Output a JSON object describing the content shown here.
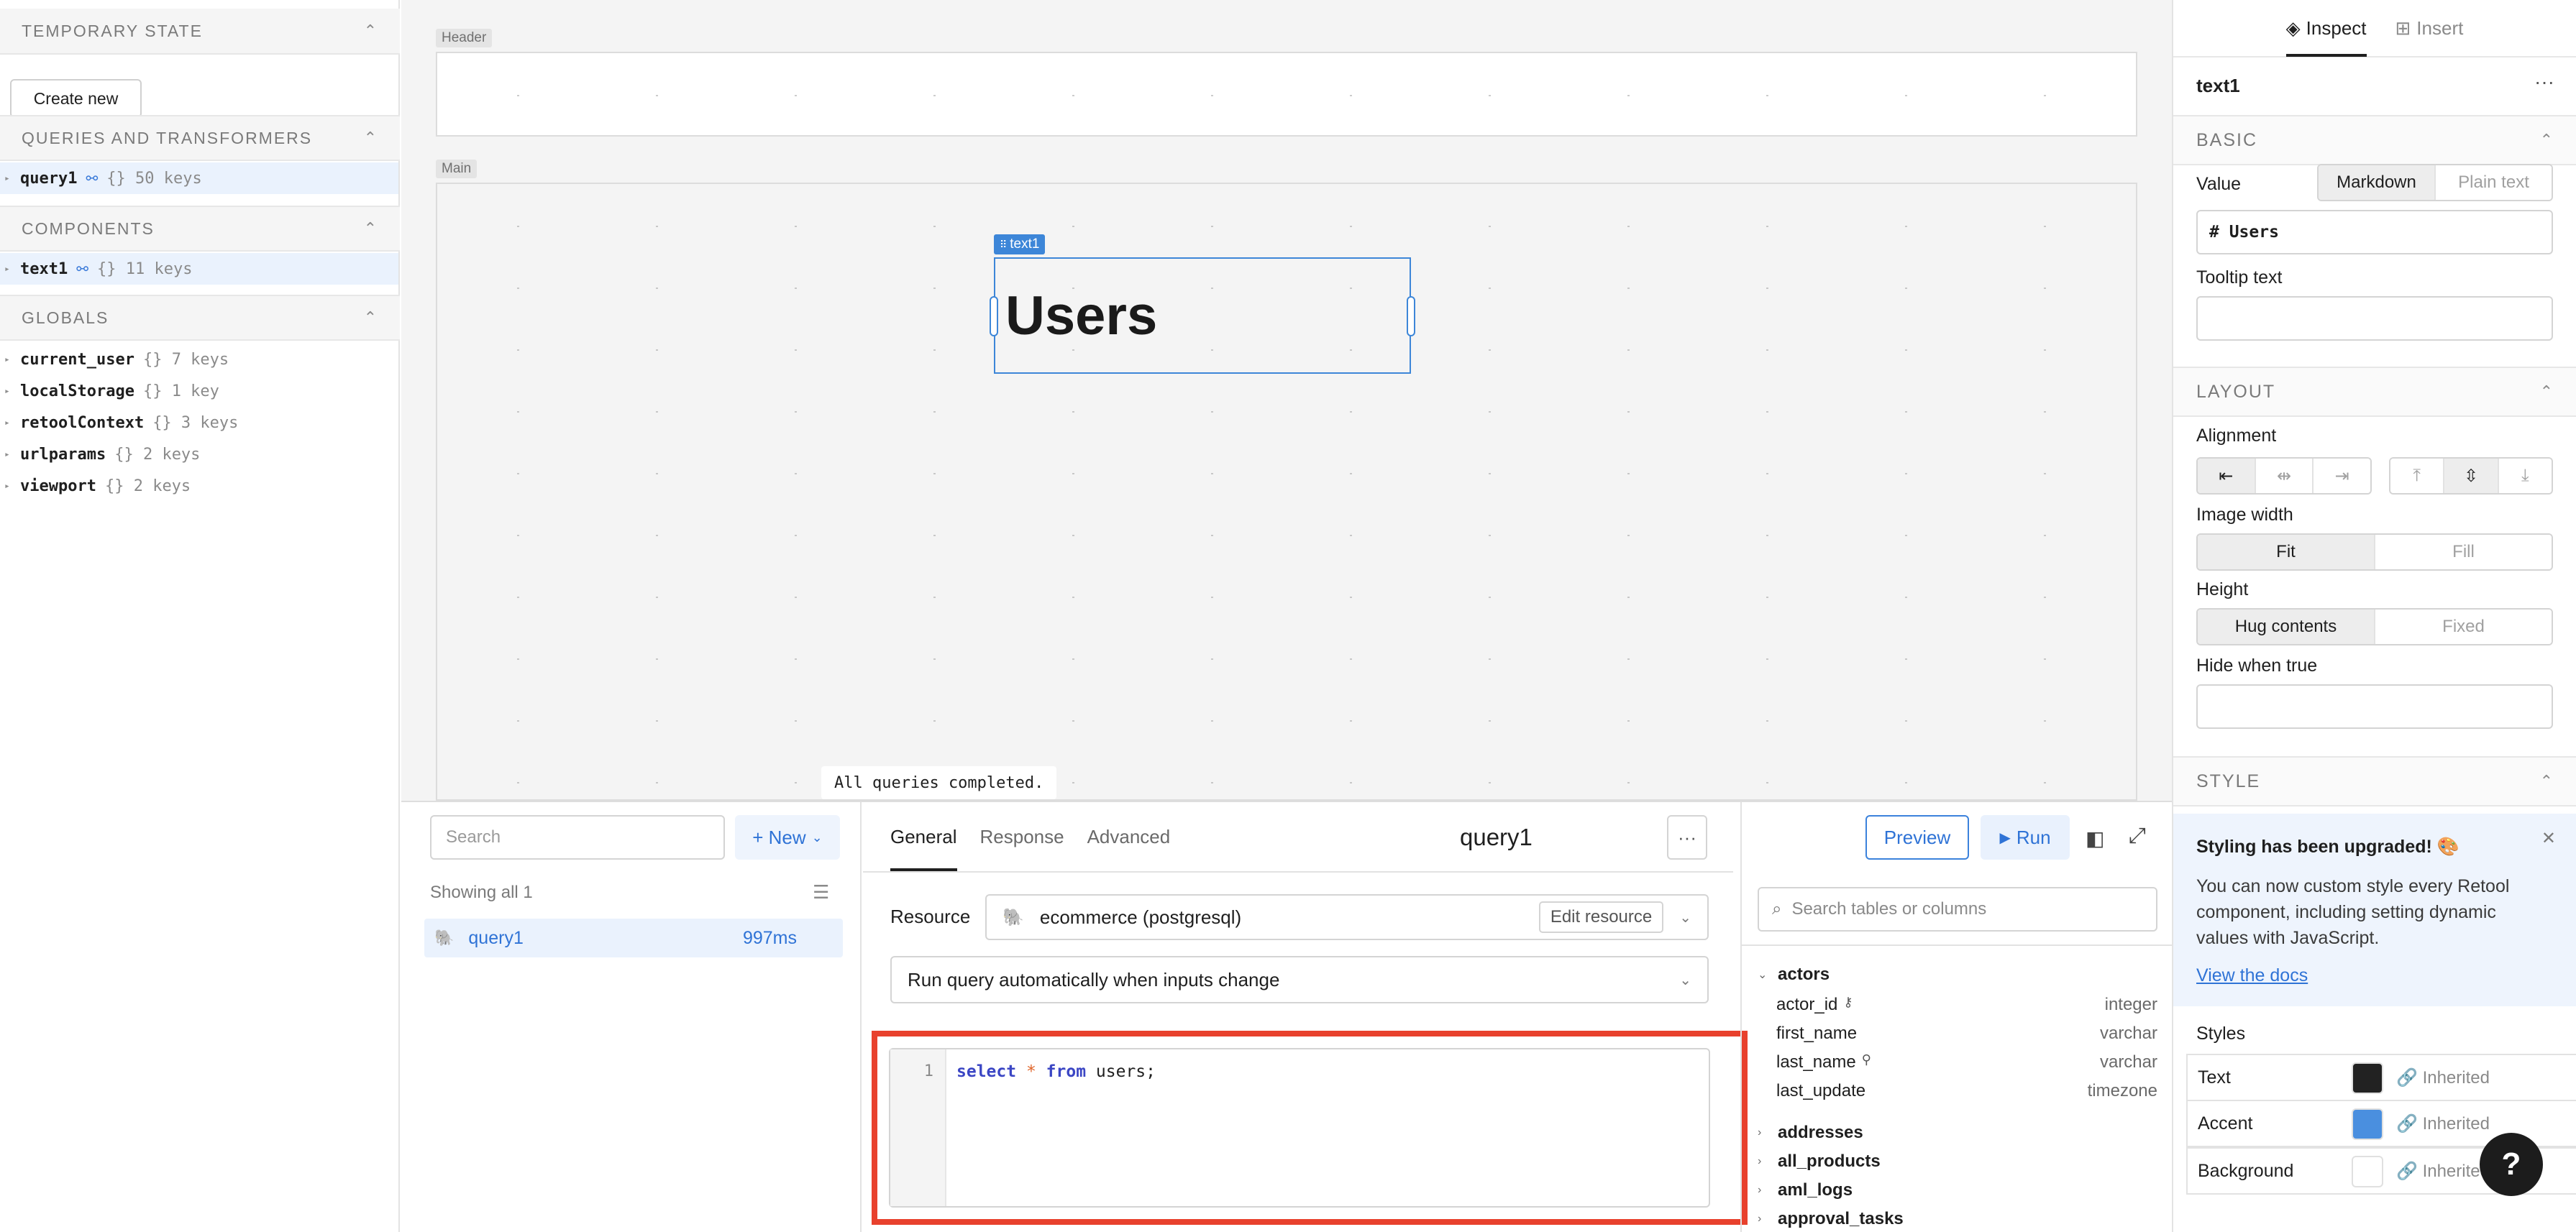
{
  "left_panel": {
    "sections": [
      {
        "title": "TEMPORARY STATE"
      },
      {
        "title": "QUERIES AND TRANSFORMERS"
      },
      {
        "title": "COMPONENTS"
      },
      {
        "title": "GLOBALS"
      }
    ],
    "create_new_label": "Create new",
    "queries": [
      {
        "name": "query1",
        "meta": "{} 50 keys"
      }
    ],
    "components": [
      {
        "name": "text1",
        "meta": "{} 11 keys"
      }
    ],
    "globals": [
      {
        "name": "current_user",
        "meta": "{} 7 keys"
      },
      {
        "name": "localStorage",
        "meta": "{} 1 key"
      },
      {
        "name": "retoolContext",
        "meta": "{} 3 keys"
      },
      {
        "name": "urlparams",
        "meta": "{} 2 keys"
      },
      {
        "name": "viewport",
        "meta": "{} 2 keys"
      }
    ]
  },
  "canvas": {
    "header_label": "Header",
    "main_label": "Main",
    "component_tag": "text1",
    "component_text": "Users",
    "status_toast": "All queries completed."
  },
  "query_list": {
    "search_placeholder": "Search",
    "new_label": "+ New",
    "showing_label": "Showing all 1",
    "items": [
      {
        "name": "query1",
        "duration": "997ms"
      }
    ]
  },
  "editor": {
    "tabs": [
      "General",
      "Response",
      "Advanced"
    ],
    "title": "query1",
    "preview_label": "Preview",
    "run_label": "Run",
    "resource_label": "Resource",
    "resource_value": "ecommerce (postgresql)",
    "edit_resource_label": "Edit resource",
    "run_mode_value": "Run query automatically when inputs change",
    "code_line_number": "1",
    "code": {
      "kw1": "select",
      "op": "*",
      "kw2": "from",
      "rest": "users;"
    }
  },
  "schema": {
    "search_placeholder": "Search tables or columns",
    "expanded_table": "actors",
    "columns": [
      {
        "name": "actor_id",
        "type": "integer",
        "key": "⚷"
      },
      {
        "name": "first_name",
        "type": "varchar",
        "key": ""
      },
      {
        "name": "last_name",
        "type": "varchar",
        "key": "⚲"
      },
      {
        "name": "last_update",
        "type": "timezone",
        "key": ""
      }
    ],
    "tables": [
      "addresses",
      "all_products",
      "aml_logs",
      "approval_tasks"
    ]
  },
  "inspector": {
    "tabs": [
      "Inspect",
      "Insert"
    ],
    "component_name": "text1",
    "basic_title": "BASIC",
    "value_label": "Value",
    "value_modes": [
      "Markdown",
      "Plain text"
    ],
    "value_content": "# Users",
    "tooltip_label": "Tooltip text",
    "layout_title": "LAYOUT",
    "alignment_label": "Alignment",
    "image_width_label": "Image width",
    "image_width_modes": [
      "Fit",
      "Fill"
    ],
    "height_label": "Height",
    "height_modes": [
      "Hug contents",
      "Fixed"
    ],
    "hide_label": "Hide when true",
    "style_title": "STYLE",
    "upgrade_title": "Styling has been upgraded! 🎨",
    "upgrade_body": "You can now custom style every Retool component, including setting dynamic values with JavaScript.",
    "upgrade_link": "View the docs",
    "styles_label": "Styles",
    "style_rows": [
      {
        "name": "Text",
        "color": "#222222",
        "value": "Inherited"
      },
      {
        "name": "Accent",
        "color": "#4a8fdf",
        "value": "Inherited"
      },
      {
        "name": "Background",
        "color": "#ffffff",
        "value": "Inherited"
      }
    ]
  },
  "help_label": "?"
}
